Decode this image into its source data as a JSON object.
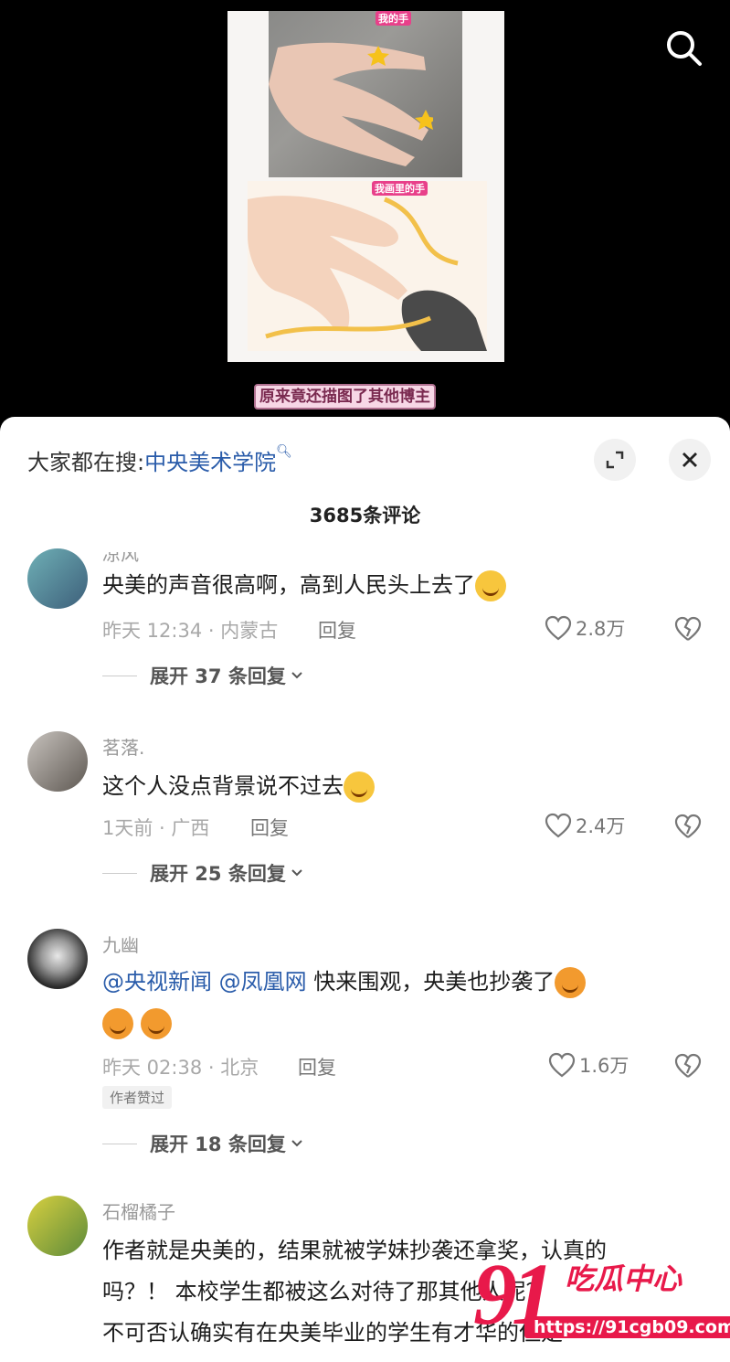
{
  "video": {
    "photo_tag_top": "我的手",
    "photo_tag_bottom": "我画里的手",
    "caption": "原来竟还描图了其他博主"
  },
  "sheet": {
    "hotsearch_prefix": "大家都在搜:",
    "hotsearch_keyword": "中央美术学院",
    "comment_count": "3685条评论"
  },
  "comments": [
    {
      "name": "凉风",
      "text": "央美的声音很高啊，高到人民头上去了",
      "meta": "昨天 12:34 · 内蒙古",
      "reply": "回复",
      "likes": "2.8万",
      "expand": "展开 37 条回复"
    },
    {
      "name": "茗落.",
      "text": "这个人没点背景说不过去",
      "meta": "1天前 · 广西",
      "reply": "回复",
      "likes": "2.4万",
      "expand": "展开 25 条回复"
    },
    {
      "name": "九幽",
      "mention1": "@央视新闻",
      "mention2": "@凤凰网",
      "text": "快来围观，央美也抄袭了",
      "meta": "昨天 02:38 · 北京",
      "reply": "回复",
      "likes": "1.6万",
      "author_badge": "作者赞过",
      "expand": "展开 18 条回复"
    },
    {
      "name": "石榴橘子",
      "line1": "作者就是央美的，结果就被学妹抄袭还拿奖，认真的",
      "line2": "吗？！ 本校学生都被这么对待了那其他人呢？",
      "line3": "不可否认确实有在央美毕业的学生有才华的但是"
    }
  ],
  "watermark": {
    "number": "91",
    "name": "吃瓜中心",
    "url": "https://91cgb09.com"
  },
  "colors": {
    "link": "#2a5caa",
    "watermark": "#e8194a"
  }
}
